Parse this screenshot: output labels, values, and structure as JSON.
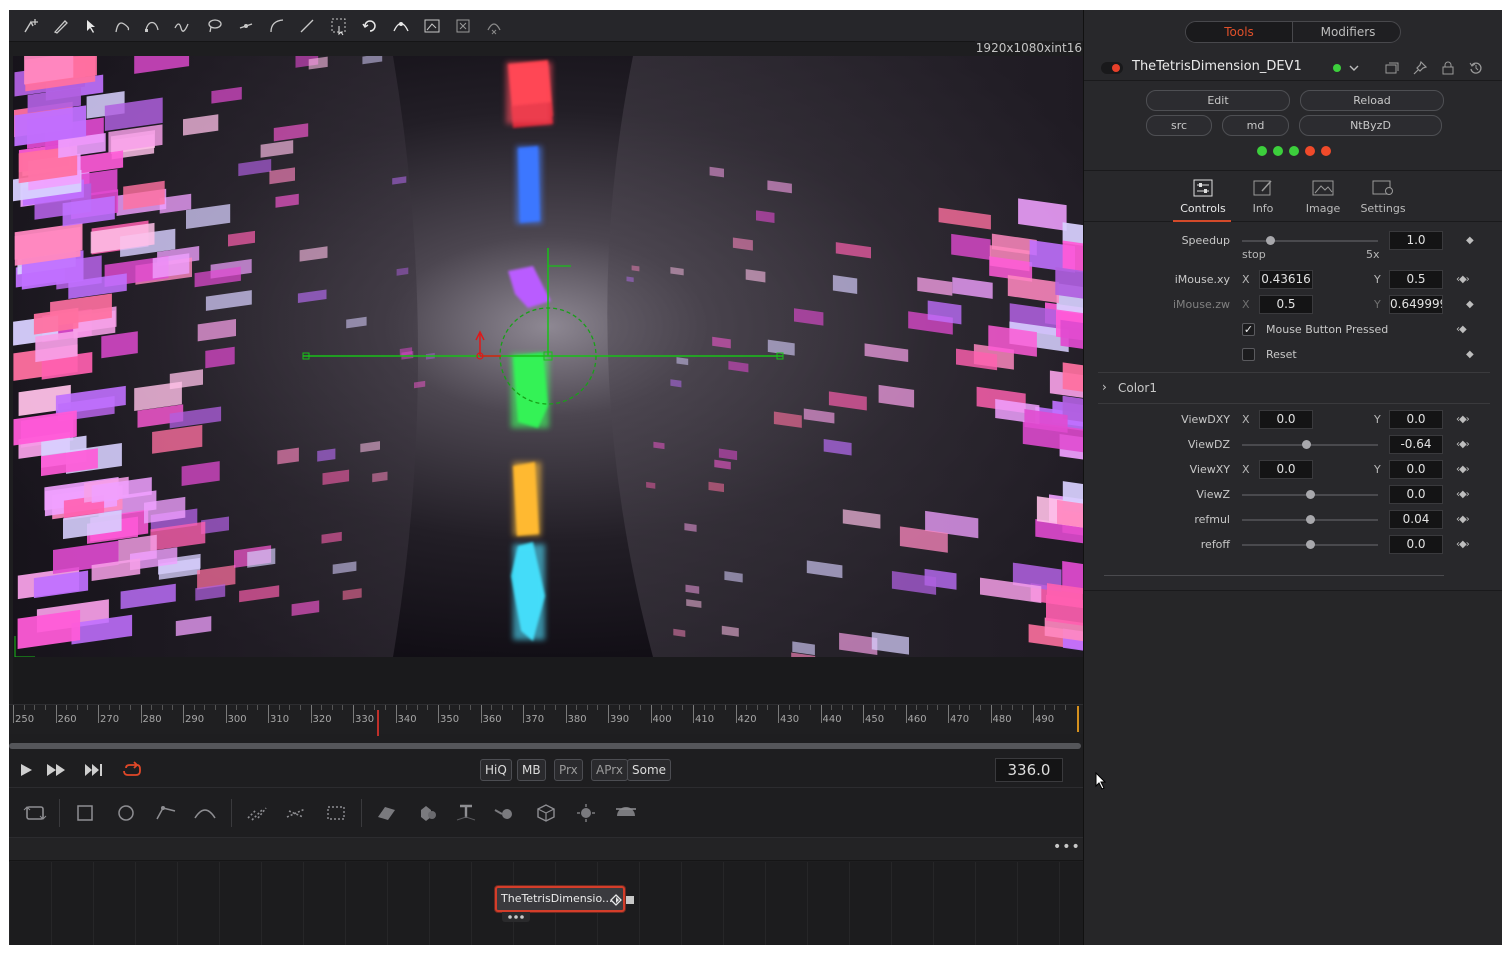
{
  "viewer": {
    "resolution": "1920x1080xint16",
    "frame_number": "336.0",
    "quality_buttons": [
      "HiQ",
      "MB",
      "Prx",
      "APrx",
      "Some"
    ]
  },
  "timeline": {
    "ticks": [
      "250",
      "260",
      "270",
      "280",
      "290",
      "300",
      "310",
      "320",
      "330",
      "340",
      "350",
      "360",
      "370",
      "380",
      "390",
      "400",
      "410",
      "420",
      "430",
      "440",
      "450",
      "460",
      "470",
      "480",
      "490"
    ]
  },
  "node": {
    "label": "TheTetrisDimensio..."
  },
  "node_header": {
    "menu": "•••"
  },
  "inspector": {
    "tabs": {
      "tools": "Tools",
      "modifiers": "Modifiers"
    },
    "tool_name": "TheTetrisDimension_DEV1",
    "buttons": {
      "edit": "Edit",
      "reload": "Reload",
      "src": "src",
      "md": "md",
      "ntbyzd": "NtByzD"
    },
    "subtabs": {
      "controls": "Controls",
      "info": "Info",
      "image": "Image",
      "settings": "Settings"
    },
    "params": {
      "speedup": {
        "label": "Speedup",
        "value": "1.0",
        "min_label": "stop",
        "max_label": "5x"
      },
      "imouse_xy": {
        "label": "iMouse.xy",
        "x": "0.43616",
        "y": "0.5"
      },
      "imouse_zw": {
        "label": "iMouse.zw",
        "x": "0.5",
        "y": "0.649999"
      },
      "mouse_button_pressed": {
        "label": "Mouse Button Pressed",
        "checked": true
      },
      "reset": {
        "label": "Reset",
        "checked": false
      },
      "color1": {
        "label": "Color1"
      },
      "viewdxy": {
        "label": "ViewDXY",
        "x": "0.0",
        "y": "0.0"
      },
      "viewdz": {
        "label": "ViewDZ",
        "value": "-0.64"
      },
      "viewxy": {
        "label": "ViewXY",
        "x": "0.0",
        "y": "0.0"
      },
      "viewz": {
        "label": "ViewZ",
        "value": "0.0"
      },
      "refmul": {
        "label": "refmul",
        "value": "0.04"
      },
      "refoff": {
        "label": "refoff",
        "value": "0.0"
      }
    },
    "axis": {
      "x": "X",
      "y": "Y"
    },
    "keyframe": "‹◆›",
    "keyframe_single": "◆",
    "status_dot_colors": [
      "#3ccf3c",
      "#3ccf3c",
      "#3ccf3c",
      "#f04a2a",
      "#f04a2a"
    ]
  }
}
